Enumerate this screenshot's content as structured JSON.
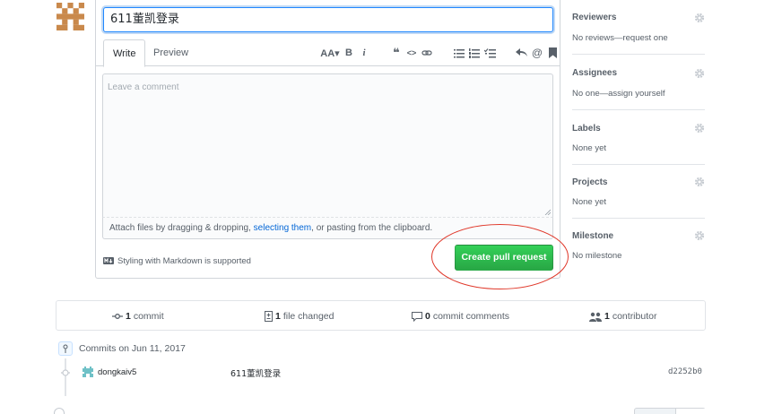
{
  "form": {
    "title_value": "611董凯登录",
    "tabs": {
      "write": "Write",
      "preview": "Preview"
    },
    "toolbar": {
      "heading": "AA▾",
      "bold": "B",
      "italic": "i",
      "quote": "❝",
      "code": "<>",
      "link": "link-icon",
      "ul": "unordered-list-icon",
      "ol": "ordered-list-icon",
      "tasks": "task-list-icon",
      "reply": "reply-icon",
      "mention": "@",
      "bookmark": "bookmark-icon"
    },
    "comment_placeholder": "Leave a comment",
    "attach_prefix": "Attach files by dragging & dropping, ",
    "attach_link": "selecting them",
    "attach_suffix": ", or pasting from the clipboard.",
    "markdown_note": "Styling with Markdown is supported",
    "create_button": "Create pull request"
  },
  "sidebar": {
    "reviewers": {
      "title": "Reviewers",
      "value": "No reviews—request one"
    },
    "assignees": {
      "title": "Assignees",
      "value": "No one—assign yourself"
    },
    "labels": {
      "title": "Labels",
      "value": "None yet"
    },
    "projects": {
      "title": "Projects",
      "value": "None yet"
    },
    "milestone": {
      "title": "Milestone",
      "value": "No milestone"
    }
  },
  "summary": {
    "commits_count": "1",
    "commits_label": "commit",
    "files_count": "1",
    "files_label": "file changed",
    "comments_count": "0",
    "comments_label": "commit comments",
    "contributors_count": "1",
    "contributors_label": "contributor"
  },
  "commits": {
    "heading": "Commits on Jun 11, 2017",
    "items": [
      {
        "author": "dongkaiv5",
        "message": "611董凯登录",
        "sha": "d2252b0"
      }
    ]
  },
  "colors": {
    "accent": "#0366d6",
    "green": "#28a745",
    "annotation": "#e0392b"
  }
}
